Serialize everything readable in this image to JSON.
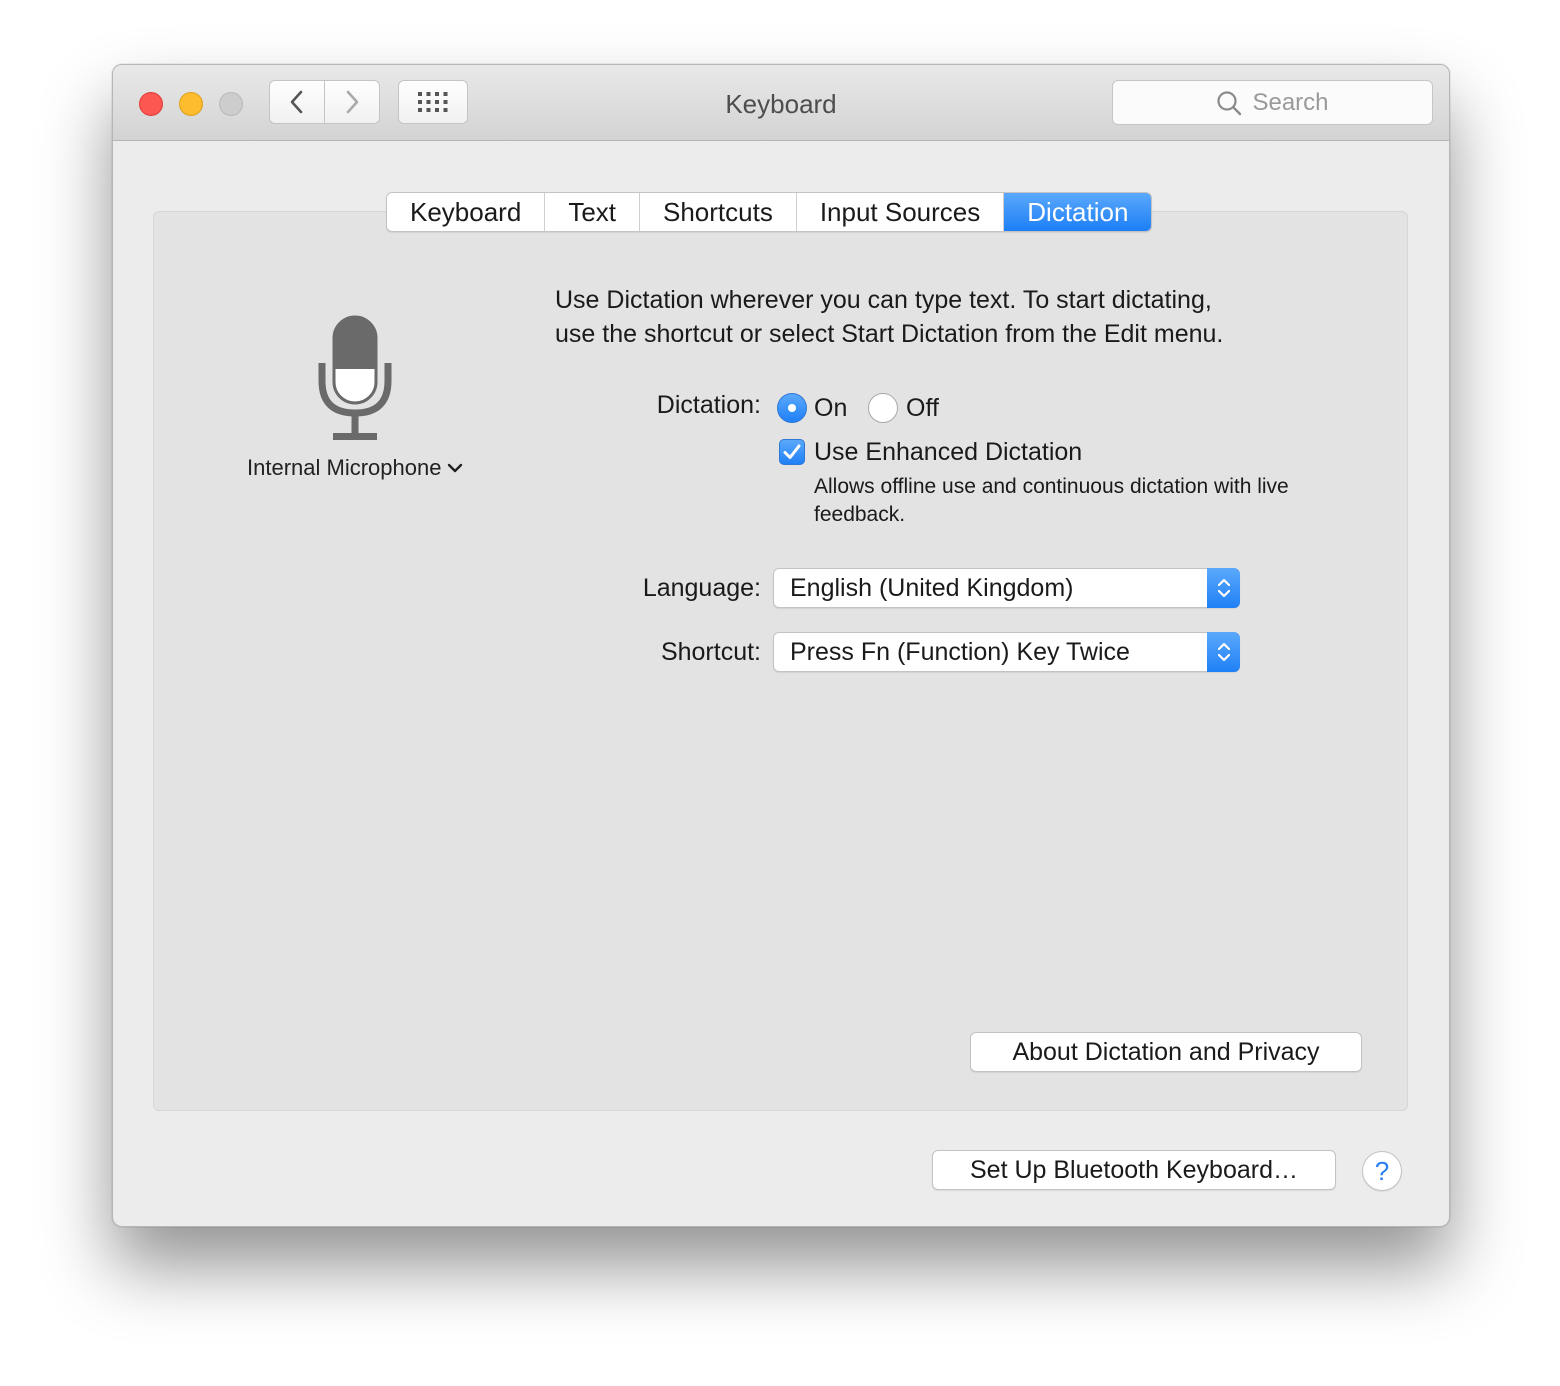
{
  "window": {
    "title": "Keyboard"
  },
  "toolbar": {
    "search_placeholder": "Search"
  },
  "tabs": [
    {
      "label": "Keyboard",
      "selected": false
    },
    {
      "label": "Text",
      "selected": false
    },
    {
      "label": "Shortcuts",
      "selected": false
    },
    {
      "label": "Input Sources",
      "selected": false
    },
    {
      "label": "Dictation",
      "selected": true
    }
  ],
  "microphone": {
    "selected": "Internal Microphone"
  },
  "dictation": {
    "intro_line1": "Use Dictation wherever you can type text. To start dictating,",
    "intro_line2": "use the shortcut or select Start Dictation from the Edit menu.",
    "label": "Dictation:",
    "on_label": "On",
    "off_label": "Off",
    "selected": "On",
    "enhanced_label": "Use Enhanced Dictation",
    "enhanced_checked": true,
    "enhanced_note": "Allows offline use and continuous dictation with live feedback.",
    "language_label": "Language:",
    "language_value": "English (United Kingdom)",
    "shortcut_label": "Shortcut:",
    "shortcut_value": "Press Fn (Function) Key Twice",
    "privacy_button": "About Dictation and Privacy"
  },
  "footer": {
    "bluetooth_button": "Set Up Bluetooth Keyboard…",
    "help_label": "?"
  },
  "colors": {
    "accent": "#1f80f6",
    "close": "#fd5752",
    "minimize": "#fdbc2e",
    "zoom_disabled": "#cdcdcd",
    "help": "#2a7ff0"
  }
}
